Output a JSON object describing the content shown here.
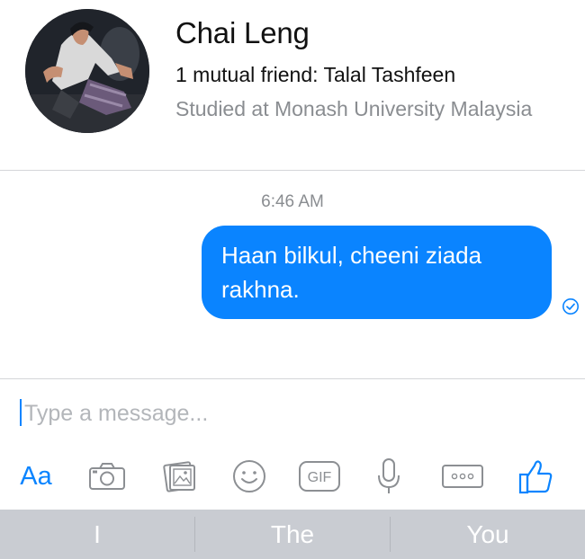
{
  "profile": {
    "name": "Chai Leng",
    "mutual": "1 mutual friend: Talal Tashfeen",
    "studied": "Studied at Monash University Malaysia"
  },
  "conversation": {
    "timestamp": "6:46 AM",
    "messages": [
      {
        "text": "Haan bilkul, cheeni ziada rakhna.",
        "from": "me",
        "status": "delivered"
      }
    ]
  },
  "composer": {
    "placeholder": "Type a message...",
    "value": "",
    "text_label": "Aa",
    "gif_label": "GIF"
  },
  "icons": [
    "camera-icon",
    "photo-gallery-icon",
    "emoji-icon",
    "gif-icon",
    "microphone-icon",
    "more-icon",
    "thumbs-up-icon"
  ],
  "keyboard": {
    "suggestions": [
      "I",
      "The",
      "You"
    ]
  },
  "colors": {
    "accent": "#0a84ff",
    "bubble_text": "#ffffff",
    "muted_text": "#8a8d91",
    "icon_gray": "#8c8f93",
    "suggestion_bar": "#c9ccd2"
  }
}
